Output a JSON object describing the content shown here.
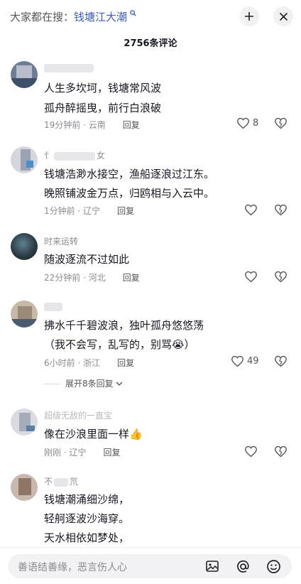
{
  "header": {
    "search_prefix": "大家都在搜：",
    "search_keyword": "钱塘江大潮",
    "comment_count": "2756条评论"
  },
  "comments": [
    {
      "user": "",
      "lines": [
        "人生多坎坷，钱塘常风波",
        "孤舟醉摇曳，前行白浪破"
      ],
      "time": "19分钟前 · 云南",
      "reply": "回复",
      "likes": "8"
    },
    {
      "user_left": "忄",
      "user_right": "女",
      "lines": [
        "钱塘浩渺水接空，渔船逐浪过江东。",
        "晚照铺波金万点，归鸥相与入云中。"
      ],
      "time": "1分钟前 · 辽宁",
      "reply": "回复",
      "likes": ""
    },
    {
      "user": "时来运转",
      "lines": [
        "随波逐流不过如此"
      ],
      "time": "22分钟前 · 河北",
      "reply": "回复",
      "likes": ""
    },
    {
      "user": "",
      "lines": [
        "拂水千千碧波浪，独叶孤舟悠悠荡",
        "（我不会写，乱写的，别骂😭）"
      ],
      "time": "6小时前 · 浙江",
      "reply": "回复",
      "likes": "49",
      "expand": "展开8条回复"
    },
    {
      "user": "超级无敌的一直宝",
      "lines": [
        "像在沙浪里面一样👍"
      ],
      "time": "刚刚 · 辽宁",
      "reply": "回复",
      "likes": ""
    },
    {
      "user_left": "不",
      "user_right": "氘",
      "lines": [
        "钱塘潮涌细沙绵，",
        "轻舸逐波沙海穿。",
        "天水相依如梦处，"
      ]
    }
  ],
  "bottom": {
    "placeholder": "善语结善缘，恶言伤人心"
  },
  "colors": {
    "keyword": "#3a5bbf",
    "meta": "#8a8b91",
    "text": "#161823"
  }
}
